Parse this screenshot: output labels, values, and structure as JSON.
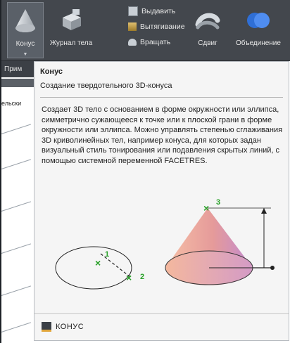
{
  "ribbon": {
    "cone_label": "Конус",
    "history_label": "Журнал тела",
    "extrude_label": "Выдавить",
    "loft_label": "Вытягивание",
    "revolve_label": "Вращать",
    "sweep_label": "Сдвиг",
    "union_label": "Объединение"
  },
  "left_panel": {
    "bar_text": "Прим",
    "tab_text": "ельски"
  },
  "tooltip": {
    "title": "Конус",
    "subtitle": "Создание твердотельного 3D-конуса",
    "description": "Создает 3D тело с основанием в форме окружности или эллипса, симметрично сужающееся к точке или к плоской грани в форме окружности или эллипса. Можно управлять степенью сглаживания 3D криволинейных тел, например конуса, для которых задан визуальный стиль тонирования или подавления скрытых линий, с помощью системной переменной FACETRES.",
    "point_labels": [
      "1",
      "2",
      "3"
    ],
    "command": "КОНУС"
  },
  "colors": {
    "ribbon_bg": "#43474d",
    "tooltip_bg": "#f5f5f5",
    "cone_fill_light": "#f4b3a0",
    "cone_fill_dark": "#c58fd0",
    "point_marker": "#2aa12a"
  }
}
